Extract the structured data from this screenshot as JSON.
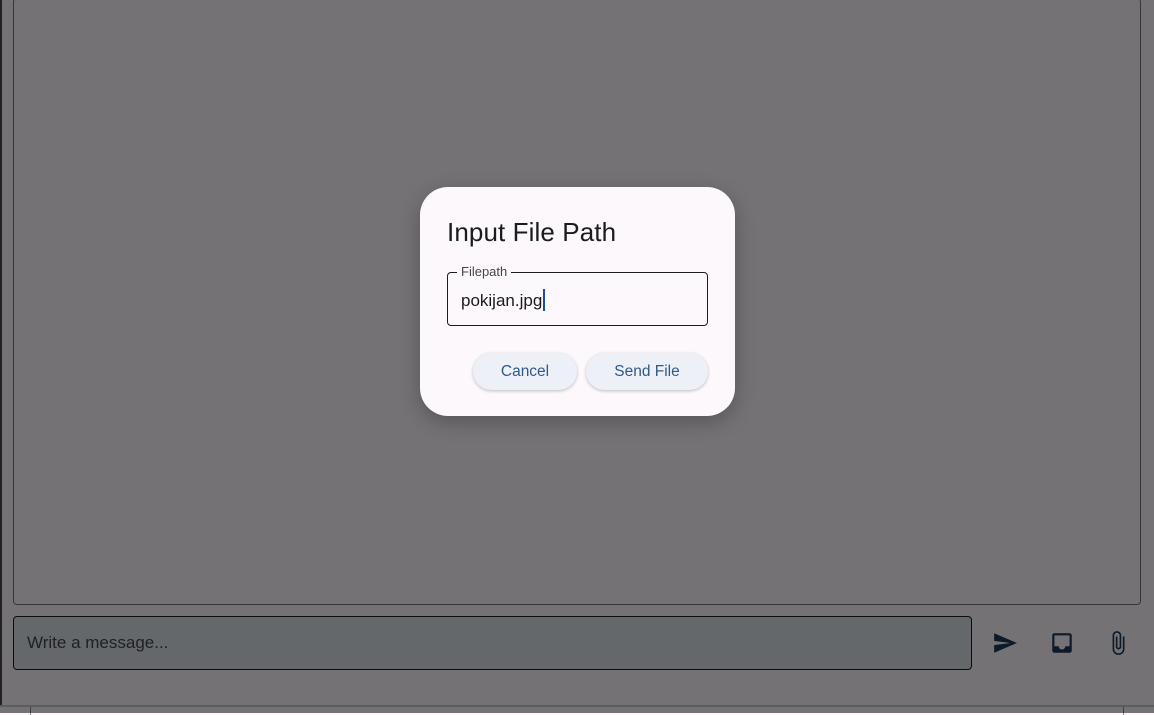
{
  "composer": {
    "placeholder": "Write a message..."
  },
  "actions": {
    "send_icon": "send-icon",
    "inbox_icon": "inbox-icon",
    "attach_icon": "paperclip-icon"
  },
  "dialog": {
    "title": "Input File Path",
    "field_label": "Filepath",
    "field_value": "pokijan.jpg",
    "cancel_label": "Cancel",
    "send_label": "Send File"
  },
  "colors": {
    "accent": "#2f5a85",
    "icon": "#1b3a5c",
    "dialog_bg": "#fcf8fc"
  }
}
